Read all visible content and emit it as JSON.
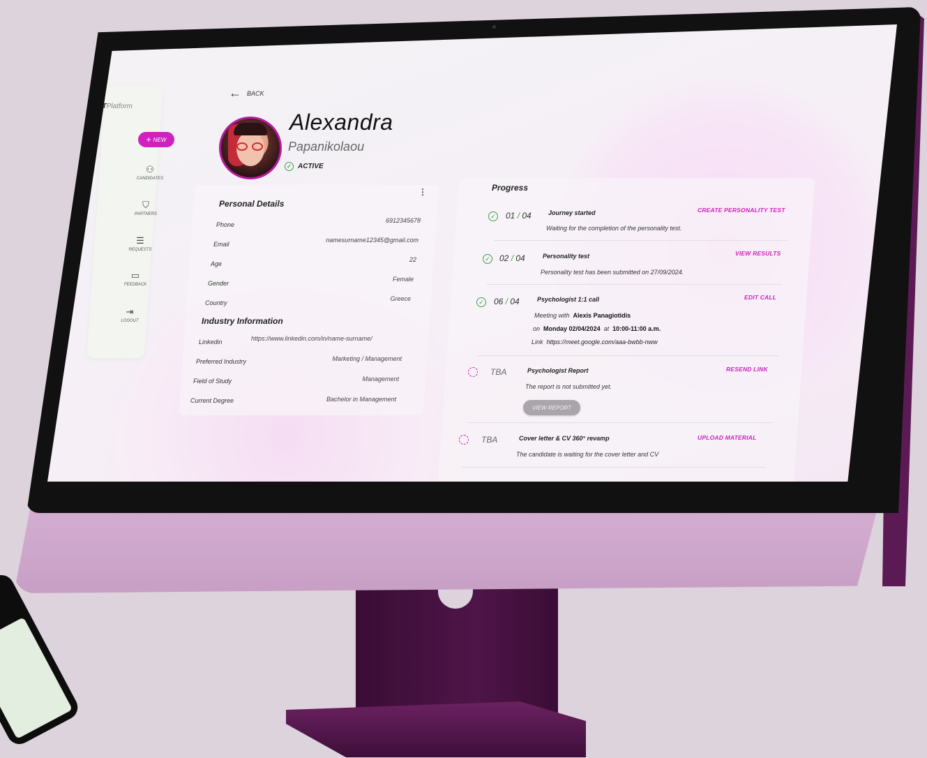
{
  "sidebar": {
    "brand_prefix": "PT",
    "brand_suffix": "Platform",
    "new_button": "NEW",
    "items": [
      {
        "label": "CANDIDATES",
        "icon": "candidates-icon"
      },
      {
        "label": "PARTNERS",
        "icon": "partners-icon"
      },
      {
        "label": "REQUESTS",
        "icon": "requests-icon"
      },
      {
        "label": "FEEDBACK",
        "icon": "feedback-icon"
      },
      {
        "label": "LOGOUT",
        "icon": "logout-icon"
      }
    ]
  },
  "header": {
    "back_label": "BACK",
    "first_name": "Alexandra",
    "last_name": "Papanikolaou",
    "status": "ACTIVE"
  },
  "personal_details": {
    "title": "Personal Details",
    "rows": [
      {
        "label": "Phone",
        "value": "6912345678"
      },
      {
        "label": "Email",
        "value": "namesurname12345@gmail.com"
      },
      {
        "label": "Age",
        "value": "22"
      },
      {
        "label": "Gender",
        "value": "Female"
      },
      {
        "label": "Country",
        "value": "Greece"
      }
    ]
  },
  "industry_information": {
    "title": "Industry Information",
    "rows": [
      {
        "label": "Linkedin",
        "value": "https://www.linkedin.com/in/name-surname/"
      },
      {
        "label": "Preferred Industry",
        "value": "Marketing / Management"
      },
      {
        "label": "Field of Study",
        "value": "Management"
      },
      {
        "label": "Current Degree",
        "value": "Bachelor in Management"
      }
    ]
  },
  "progress": {
    "title": "Progress",
    "steps": [
      {
        "num_a": "01",
        "num_b": "04",
        "title": "Journey started",
        "desc": "Waiting for the completion of the personality test.",
        "action": "CREATE PERSONALITY TEST"
      },
      {
        "num_a": "02",
        "num_b": "04",
        "title": "Personality test",
        "desc": "Personality test has been submitted on 27/09/2024.",
        "action": "VIEW RESULTS"
      },
      {
        "num_a": "06",
        "num_b": "04",
        "title": "Psychologist 1:1 call",
        "meeting_prefix": "Meeting with",
        "meeting_person": "Alexis Panagiotidis",
        "on_prefix": "on",
        "date": "Monday 02/04/2024",
        "at_prefix": "at",
        "time": "10:00-11:00 a.m.",
        "link_prefix": "Link",
        "link": "https://meet.google.com/aaa-bwbb-nww",
        "action": "EDIT CALL"
      },
      {
        "label": "TBA",
        "title": "Psychologist Report",
        "desc": "The report is not submitted yet.",
        "button": "VIEW REPORT",
        "action": "RESEND LINK"
      },
      {
        "label": "TBA",
        "title": "Cover letter & CV 360° revamp",
        "desc": "The candidate is waiting for the cover letter and CV",
        "action": "UPLOAD MATERIAL"
      }
    ]
  },
  "colors": {
    "accent": "#d020c0",
    "success": "#39a24a",
    "monitor_body": "#c79fc4",
    "stand": "#4e1548"
  }
}
